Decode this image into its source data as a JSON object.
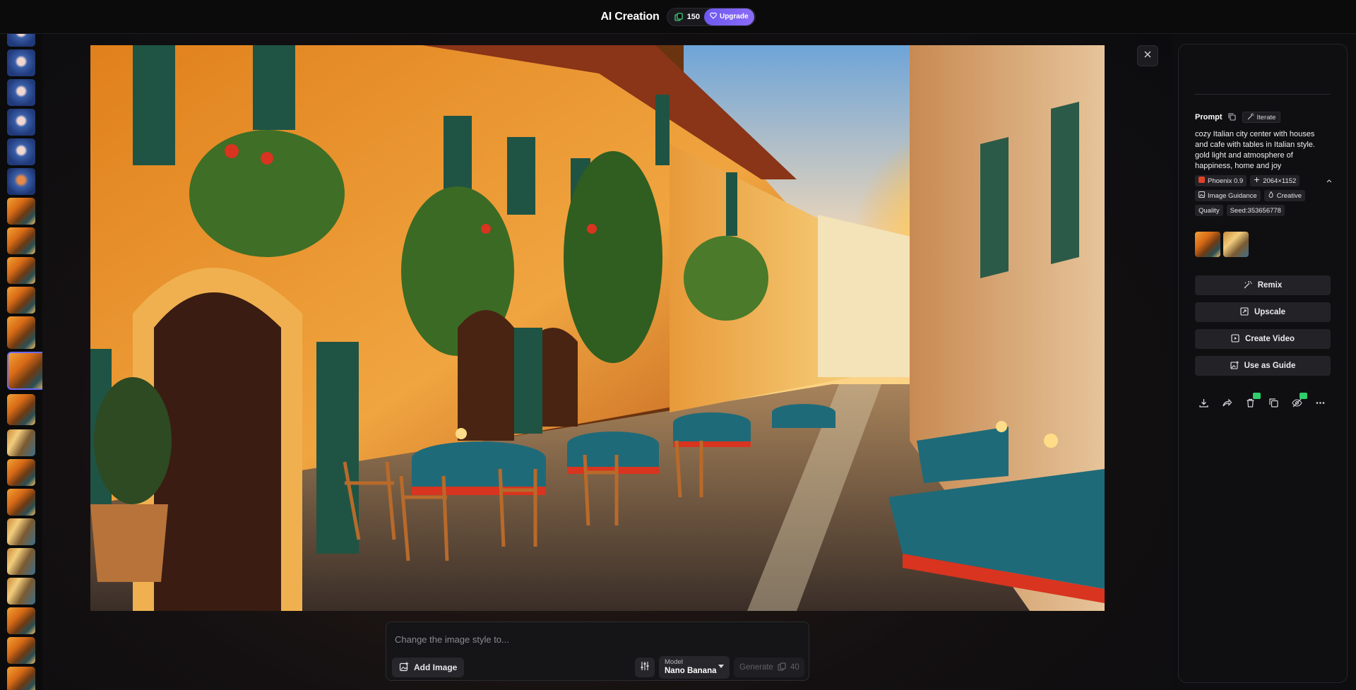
{
  "topbar": {
    "title": "AI Creation",
    "credits": "150",
    "upgrade_label": "Upgrade"
  },
  "composer": {
    "placeholder": "Change the image style to...",
    "add_image_label": "Add Image",
    "model_label": "Model",
    "model_value": "Nano Banana",
    "generate_label": "Generate",
    "generate_cost": "40"
  },
  "panel": {
    "prompt_label": "Prompt",
    "iterate_label": "Iterate",
    "prompt_text": "cozy Italian city center with houses and cafe with tables in Italian style. gold light and atmosphere of happiness, home and joy",
    "chips": {
      "model": "Phoenix 0.9",
      "size": "2064×1152",
      "guidance": "Image Guidance",
      "mode": "Creative",
      "quality": "Quality",
      "seed": "Seed:353656778"
    },
    "actions": {
      "remix": "Remix",
      "upscale": "Upscale",
      "create_video": "Create Video",
      "use_as_guide": "Use as Guide"
    }
  },
  "colors": {
    "accent": "#6d58f0",
    "badge": "#2fcf6d",
    "active_thumb": "#6d6af8"
  },
  "icons": [
    "token-icon",
    "heart-icon",
    "close-icon",
    "image-add-icon",
    "sliders-icon",
    "copy-icon",
    "iterate-icon",
    "download-icon",
    "share-icon",
    "trash-icon",
    "duplicate-icon",
    "hide-icon",
    "more-icon"
  ]
}
